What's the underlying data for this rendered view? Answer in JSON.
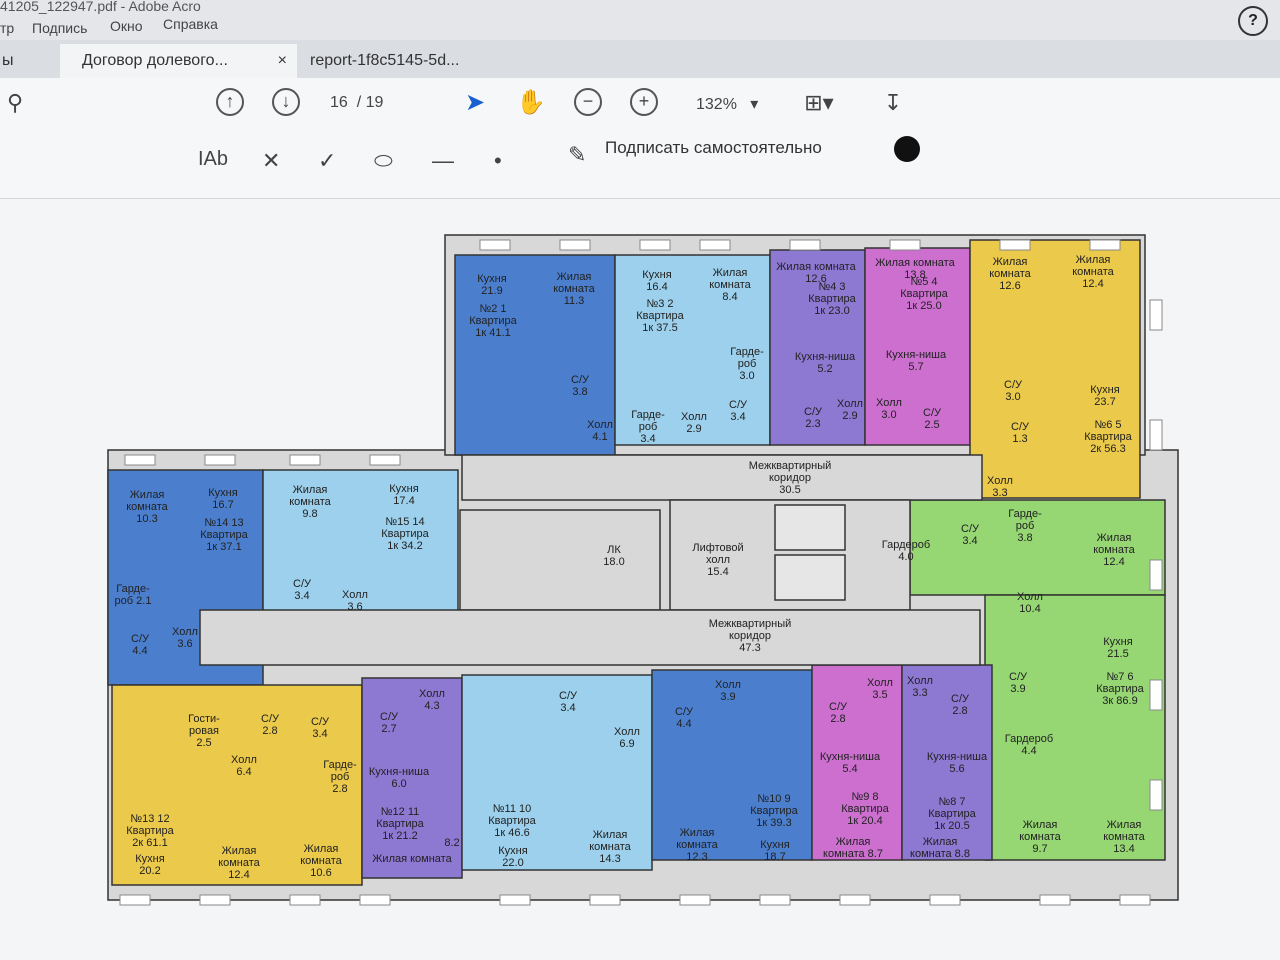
{
  "app": {
    "title_fragment": "41205_122947.pdf - Adobe Acro",
    "menu": [
      "тр",
      "Подпись",
      "Окно",
      "Справка"
    ],
    "left_fragment": "ы",
    "help_label": "?"
  },
  "tabs": [
    {
      "label": "Договор долевого...",
      "close": "×"
    },
    {
      "label": "report-1f8c5145-5d..."
    }
  ],
  "toolbar": {
    "page_current": "16",
    "page_separator": "/",
    "page_total": "19",
    "zoom": "132%"
  },
  "signbar": {
    "text_tool": "IAb",
    "sign_label": "Подписать самостоятельно",
    "color": "#111111"
  },
  "plan": {
    "colors": {
      "blue": "#4b7fcd",
      "lightblue": "#9cd0ec",
      "purple": "#8d78d2",
      "pink": "#cc6fcf",
      "yellow": "#ebc94a",
      "green": "#96d673",
      "corridor": "#d8d8d8",
      "wall": "#333333"
    },
    "rooms": [
      {
        "lines": [
          "Кухня",
          "21.9"
        ]
      },
      {
        "lines": [
          "Жилая",
          "комната",
          "11.3"
        ]
      },
      {
        "lines": [
          "№2    1",
          "Квартира",
          "1к    41.1"
        ]
      },
      {
        "lines": [
          "С/У",
          "3.8"
        ]
      },
      {
        "lines": [
          "Холл",
          "4.1"
        ]
      },
      {
        "lines": [
          "Кухня",
          "16.4"
        ]
      },
      {
        "lines": [
          "Жилая",
          "комната",
          "8.4"
        ]
      },
      {
        "lines": [
          "№3    2",
          "Квартира",
          "1к    37.5"
        ]
      },
      {
        "lines": [
          "Гарде-",
          "роб",
          "3.0"
        ]
      },
      {
        "lines": [
          "С/У",
          "3.4"
        ]
      },
      {
        "lines": [
          "Гарде-",
          "роб",
          "3.4"
        ]
      },
      {
        "lines": [
          "Холл",
          "2.9"
        ]
      },
      {
        "lines": [
          "Жилая комната",
          "12.6"
        ]
      },
      {
        "lines": [
          "№4    3",
          "Квартира",
          "1к    23.0"
        ]
      },
      {
        "lines": [
          "Кухня-ниша",
          "5.2"
        ]
      },
      {
        "lines": [
          "С/У",
          "2.3"
        ]
      },
      {
        "lines": [
          "Холл",
          "2.9"
        ]
      },
      {
        "lines": [
          "Жилая комната",
          "13.8"
        ]
      },
      {
        "lines": [
          "№5    4",
          "Квартира",
          "1к    25.0"
        ]
      },
      {
        "lines": [
          "Кухня-ниша",
          "5.7"
        ]
      },
      {
        "lines": [
          "Холл",
          "3.0"
        ]
      },
      {
        "lines": [
          "С/У",
          "2.5"
        ]
      },
      {
        "lines": [
          "Жилая",
          "комната",
          "12.6"
        ]
      },
      {
        "lines": [
          "Жилая",
          "комната",
          "12.4"
        ]
      },
      {
        "lines": [
          "С/У",
          "3.0"
        ]
      },
      {
        "lines": [
          "Кухня",
          "23.7"
        ]
      },
      {
        "lines": [
          "С/У",
          "1.3"
        ]
      },
      {
        "lines": [
          "№6    5",
          "Квартира",
          "2к    56.3"
        ]
      },
      {
        "lines": [
          "Холл",
          "3.3"
        ]
      },
      {
        "lines": [
          "Межквартирный",
          "коридор",
          "30.5"
        ]
      },
      {
        "lines": [
          "Жилая",
          "комната",
          "10.3"
        ]
      },
      {
        "lines": [
          "Кухня",
          "16.7"
        ]
      },
      {
        "lines": [
          "№14    13",
          "Квартира",
          "1к    37.1"
        ]
      },
      {
        "lines": [
          "Гарде-",
          "роб    2.1"
        ]
      },
      {
        "lines": [
          "С/У",
          "4.4"
        ]
      },
      {
        "lines": [
          "Холл",
          "3.6"
        ]
      },
      {
        "lines": [
          "Жилая",
          "комната",
          "9.8"
        ]
      },
      {
        "lines": [
          "Кухня",
          "17.4"
        ]
      },
      {
        "lines": [
          "№15    14",
          "Квартира",
          "1к    34.2"
        ]
      },
      {
        "lines": [
          "С/У",
          "3.4"
        ]
      },
      {
        "lines": [
          "Холл",
          "3.6"
        ]
      },
      {
        "lines": [
          "ЛК",
          "18.0"
        ]
      },
      {
        "lines": [
          "Лифтовой",
          "холл",
          "15.4"
        ]
      },
      {
        "lines": [
          "Гардероб",
          "4.0"
        ]
      },
      {
        "lines": [
          "С/У",
          "3.4"
        ]
      },
      {
        "lines": [
          "Гарде-",
          "роб",
          "3.8"
        ]
      },
      {
        "lines": [
          "Жилая",
          "комната",
          "12.4"
        ]
      },
      {
        "lines": [
          "Холл",
          "10.4"
        ]
      },
      {
        "lines": [
          "Межквартирный",
          "коридор",
          "47.3"
        ]
      },
      {
        "lines": [
          "Кухня",
          "21.5"
        ]
      },
      {
        "lines": [
          "№7    6",
          "Квартира",
          "3к    86.9"
        ]
      },
      {
        "lines": [
          "С/У",
          "3.9"
        ]
      },
      {
        "lines": [
          "Гардероб",
          "4.4"
        ]
      },
      {
        "lines": [
          "Жилая",
          "комната",
          "9.7"
        ]
      },
      {
        "lines": [
          "Жилая",
          "комната",
          "13.4"
        ]
      },
      {
        "lines": [
          "Гости-",
          "ровая",
          "2.5"
        ]
      },
      {
        "lines": [
          "С/У",
          "2.8"
        ]
      },
      {
        "lines": [
          "С/У",
          "3.4"
        ]
      },
      {
        "lines": [
          "Холл",
          "6.4"
        ]
      },
      {
        "lines": [
          "Гарде-",
          "роб",
          "2.8"
        ]
      },
      {
        "lines": [
          "№13    12",
          "Квартира",
          "2к    61.1"
        ]
      },
      {
        "lines": [
          "Кухня",
          "20.2"
        ]
      },
      {
        "lines": [
          "Жилая",
          "комната",
          "12.4"
        ]
      },
      {
        "lines": [
          "Жилая",
          "комната",
          "10.6"
        ]
      },
      {
        "lines": [
          "Холл",
          "4.3"
        ]
      },
      {
        "lines": [
          "С/У",
          "2.7"
        ]
      },
      {
        "lines": [
          "Кухня-ниша",
          "6.0"
        ]
      },
      {
        "lines": [
          "№12    11",
          "Квартира",
          "1к    21.2"
        ]
      },
      {
        "lines": [
          "8.2"
        ]
      },
      {
        "lines": [
          "Жилая комната"
        ]
      },
      {
        "lines": [
          "С/У",
          "3.4"
        ]
      },
      {
        "lines": [
          "Холл",
          "6.9"
        ]
      },
      {
        "lines": [
          "№11    10",
          "Квартира",
          "1к    46.6"
        ]
      },
      {
        "lines": [
          "Кухня",
          "22.0"
        ]
      },
      {
        "lines": [
          "Жилая",
          "комната",
          "14.3"
        ]
      },
      {
        "lines": [
          "Холл",
          "3.9"
        ]
      },
      {
        "lines": [
          "С/У",
          "4.4"
        ]
      },
      {
        "lines": [
          "№10    9",
          "Квартира",
          "1к    39.3"
        ]
      },
      {
        "lines": [
          "Жилая",
          "комната",
          "12.3"
        ]
      },
      {
        "lines": [
          "Кухня",
          "18.7"
        ]
      },
      {
        "lines": [
          "Холл",
          "3.5"
        ]
      },
      {
        "lines": [
          "С/У",
          "2.8"
        ]
      },
      {
        "lines": [
          "Кухня-ниша",
          "5.4"
        ]
      },
      {
        "lines": [
          "№9    8",
          "Квартира",
          "1к    20.4"
        ]
      },
      {
        "lines": [
          "Жилая",
          "комната 8.7"
        ]
      },
      {
        "lines": [
          "Холл",
          "3.3"
        ]
      },
      {
        "lines": [
          "С/У",
          "2.8"
        ]
      },
      {
        "lines": [
          "Кухня-ниша",
          "5.6"
        ]
      },
      {
        "lines": [
          "№8    7",
          "Квартира",
          "1к    20.5"
        ]
      },
      {
        "lines": [
          "Жилая",
          "комната 8.8"
        ]
      }
    ]
  }
}
